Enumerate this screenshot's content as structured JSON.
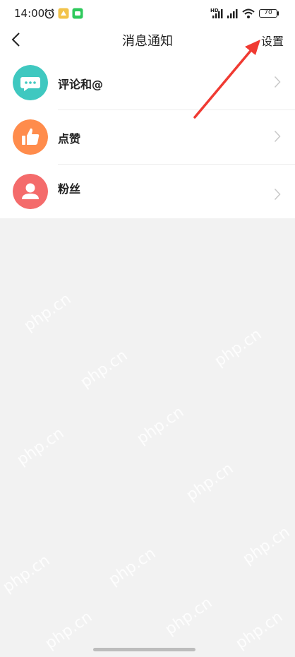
{
  "status_bar": {
    "time": "14:00",
    "battery": "70",
    "network_badge": "HD",
    "icons": [
      "alarm-icon",
      "app-notify-icon",
      "wechat-icon",
      "signal-icon",
      "signal-icon",
      "wifi-icon",
      "battery-icon"
    ]
  },
  "nav": {
    "title": "消息通知",
    "action": "设置",
    "back_icon": "chevron-left-icon"
  },
  "list": [
    {
      "label": "评论和@",
      "icon": "comment-icon",
      "color": "#3fc8c0"
    },
    {
      "label": "点赞",
      "icon": "thumb-up-icon",
      "color": "#ff8c4c"
    },
    {
      "label": "粉丝",
      "icon": "person-icon",
      "color": "#f46b6b"
    }
  ],
  "watermark": "php.cn",
  "colors": {
    "annotation_arrow": "#f03a32",
    "background": "#f2f2f2"
  }
}
